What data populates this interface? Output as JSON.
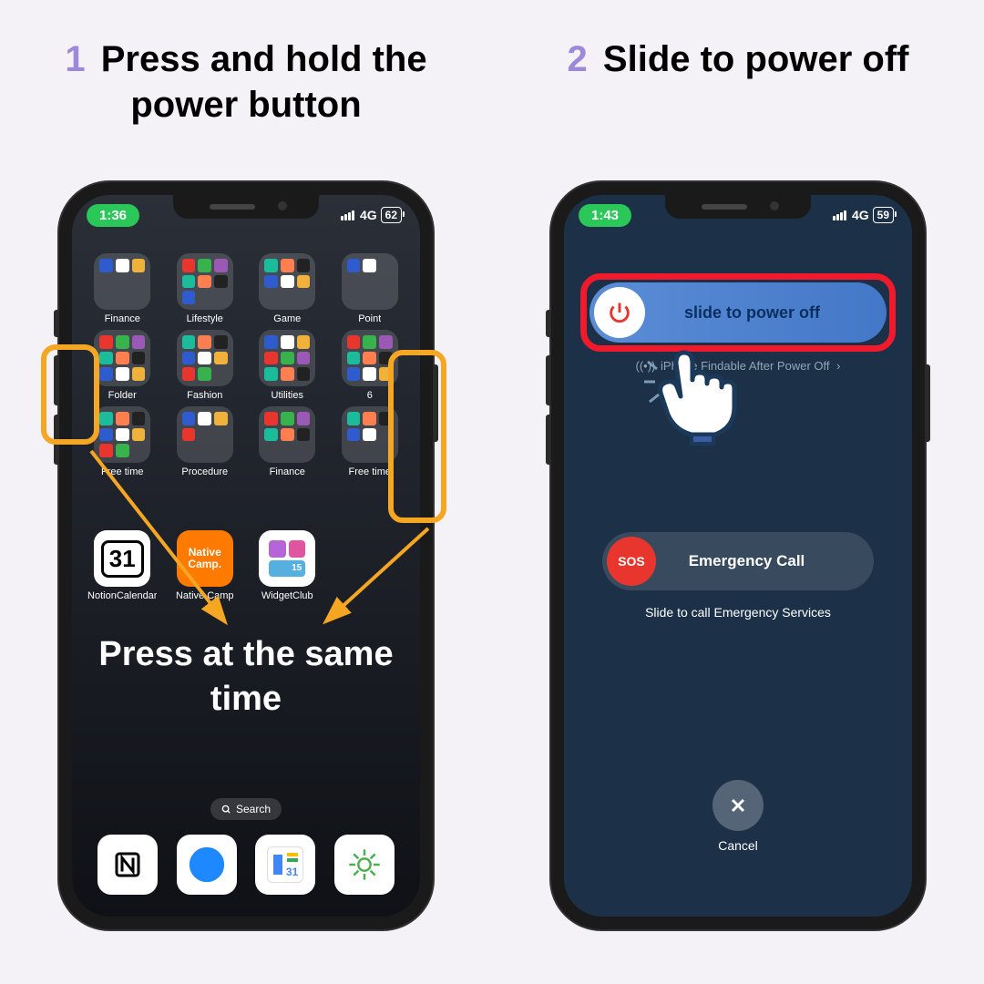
{
  "steps": {
    "s1": {
      "num": "1",
      "title": "Press and hold the power button"
    },
    "s2": {
      "num": "2",
      "title": "Slide to power off"
    }
  },
  "phone1": {
    "status": {
      "time": "1:36",
      "net": "4G",
      "battery": "62"
    },
    "folders": [
      {
        "label": "Finance"
      },
      {
        "label": "Lifestyle"
      },
      {
        "label": "Game"
      },
      {
        "label": "Point"
      },
      {
        "label": "Folder"
      },
      {
        "label": "Fashion"
      },
      {
        "label": "Utilities"
      },
      {
        "label": "6"
      },
      {
        "label": "Free time"
      },
      {
        "label": "Procedure"
      },
      {
        "label": "Finance"
      },
      {
        "label": "Free time"
      }
    ],
    "apps": [
      {
        "label": "NotionCalendar"
      },
      {
        "label": "Native Camp"
      },
      {
        "label": "WidgetClub"
      }
    ],
    "overlay": "Press at the same time",
    "search": "Search"
  },
  "phone2": {
    "status": {
      "time": "1:43",
      "net": "4G",
      "battery": "59"
    },
    "slide_label": "slide to power off",
    "findable": "iPhone Findable After Power Off",
    "sos": "SOS",
    "emergency": "Emergency Call",
    "emergency_sub": "Slide to call Emergency Services",
    "cancel": "Cancel"
  },
  "colors": {
    "mini_palette": [
      "#2e5ccf",
      "#ffffff",
      "#f0b23a",
      "#e8352e",
      "#37b24d",
      "#9b59b6",
      "#1abc9c",
      "#ff7f50",
      "#222"
    ]
  }
}
